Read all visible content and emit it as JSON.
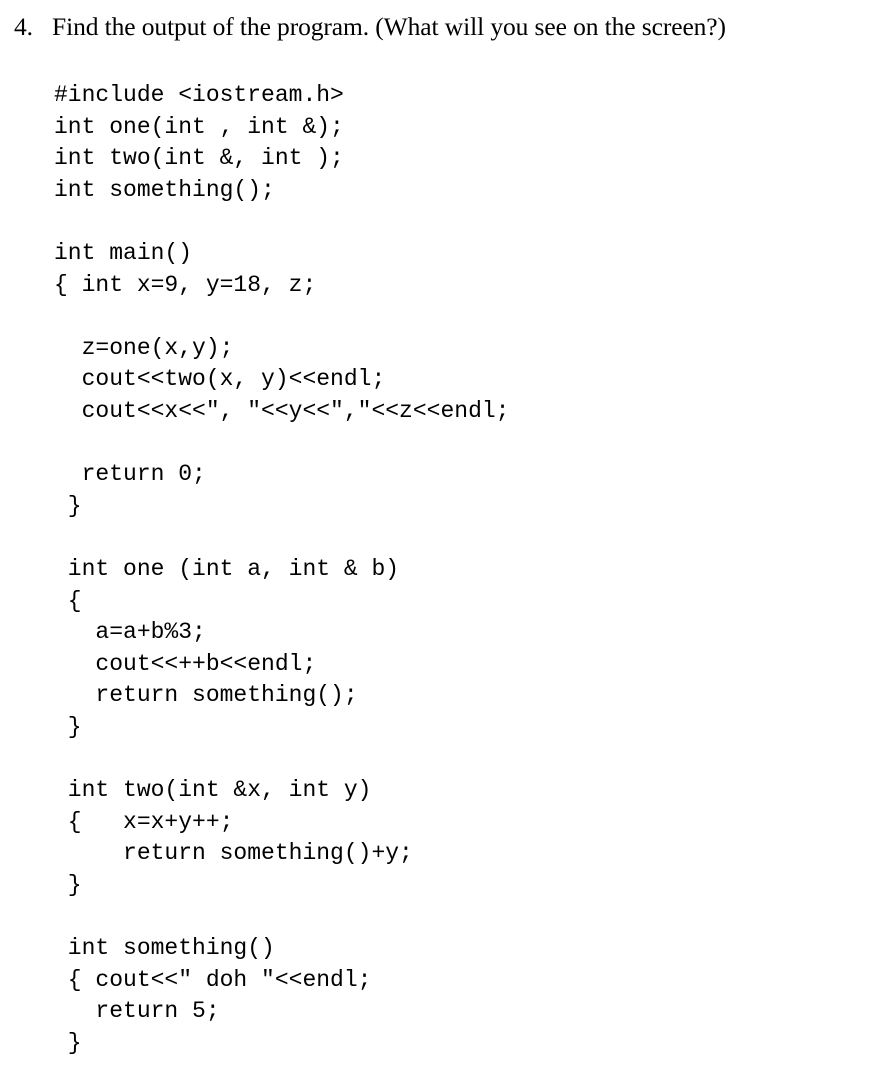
{
  "question": {
    "number": "4.",
    "text": "Find the output of the program. (What will you see on the screen?)"
  },
  "code": {
    "language": "cpp",
    "lines": [
      "#include <iostream.h>",
      "int one(int , int &);",
      "int two(int &, int );",
      "int something();",
      "",
      "int main()",
      "{ int x=9, y=18, z;",
      "",
      "  z=one(x,y);",
      "  cout<<two(x, y)<<endl;",
      "  cout<<x<<\", \"<<y<<\",\"<<z<<endl;",
      "",
      "  return 0;",
      " }",
      "",
      " int one (int a, int & b)",
      " {",
      "   a=a+b%3;",
      "   cout<<++b<<endl;",
      "   return something();",
      " }",
      "",
      " int two(int &x, int y)",
      " {   x=x+y++;",
      "     return something()+y;",
      " }",
      "",
      " int something()",
      " { cout<<\" doh \"<<endl;",
      "   return 5;",
      " }"
    ]
  },
  "colors": {
    "background": "#ffffff",
    "text": "#000000"
  }
}
